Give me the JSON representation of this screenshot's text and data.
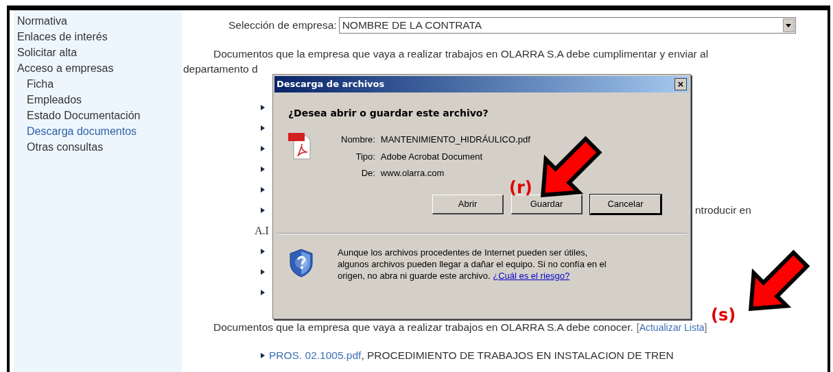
{
  "sidebar": {
    "items": [
      {
        "label": "Normativa",
        "selected": false
      },
      {
        "label": "Enlaces de interés",
        "selected": false
      },
      {
        "label": "Solicitar alta",
        "selected": false
      },
      {
        "label": "Acceso a empresas",
        "selected": false,
        "children": [
          {
            "label": "Ficha",
            "selected": false
          },
          {
            "label": "Empleados",
            "selected": false
          },
          {
            "label": "Estado Documentación",
            "selected": false
          },
          {
            "label": "Descarga documentos",
            "selected": true
          },
          {
            "label": "Otras consultas",
            "selected": false
          }
        ]
      }
    ]
  },
  "company_select": {
    "label": "Selección de empresa:",
    "value": "NOMBRE DE LA CONTRATA"
  },
  "intro_lines": [
    "Documentos que la empresa que vaya a realizar trabajos en OLARRA S.A debe cumplimentar y enviar al",
    "departamento d"
  ],
  "form_rows": [
    {
      "bullet": true
    },
    {
      "bullet": true
    },
    {
      "bullet": true
    },
    {
      "bullet": true
    },
    {
      "bullet": true
    },
    {
      "bullet": true,
      "trailing_text": "ntroducir en"
    },
    {
      "bullet": false,
      "text": "A.I"
    },
    {
      "bullet": true
    },
    {
      "bullet": true
    },
    {
      "bullet": true
    }
  ],
  "known_docs": {
    "text": "Documentos que la empresa que vaya a realizar trabajos en OLARRA S.A debe conocer.",
    "link_open": "[",
    "link": "Actualizar Lista",
    "link_close": "]"
  },
  "doc_list": [
    {
      "file": "PROS. 02.1005.pdf",
      "description": ", PROCEDIMIENTO DE TRABAJOS EN INSTALACION DE TREN"
    }
  ],
  "dialog": {
    "title": "Descarga de archivos",
    "close": "×",
    "question": "¿Desea abrir o guardar este archivo?",
    "fields": [
      {
        "label": "Nombre:",
        "value": "MANTENIMIENTO_HIDRÁULICO.pdf"
      },
      {
        "label": "Tipo:",
        "value": "Adobe Acrobat Document"
      },
      {
        "label": "De:",
        "value": "www.olarra.com"
      }
    ],
    "buttons": [
      {
        "label": "Abrir",
        "default": false
      },
      {
        "label": "Guardar",
        "default": false
      },
      {
        "label": "Cancelar",
        "default": true
      }
    ],
    "warning": "Aunque los archivos procedentes de Internet pueden ser útiles, algunos archivos pueden llegar a dañar el equipo. Si no confía en el origen, no abra ni guarde este archivo.",
    "warning_link": "¿Cuál es el riesgo?"
  },
  "annotations": [
    {
      "label": "(r)"
    },
    {
      "label": "(s)"
    }
  ]
}
